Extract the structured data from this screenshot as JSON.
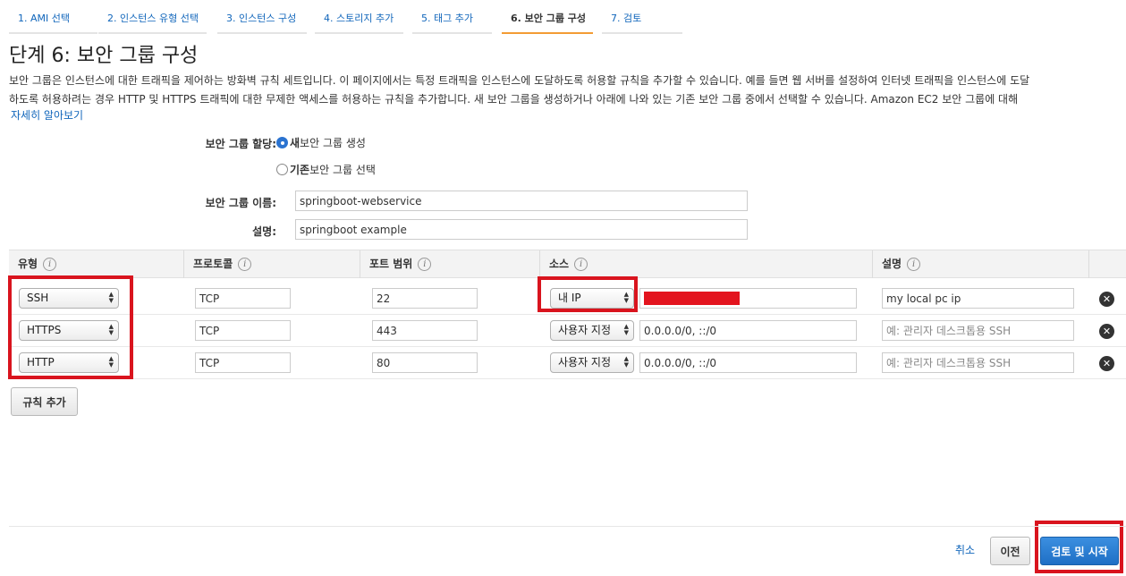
{
  "wizard": {
    "steps": [
      "1. AMI 선택",
      "2. 인스턴스 유형 선택",
      "3. 인스턴스 구성",
      "4. 스토리지 추가",
      "5. 태그 추가",
      "6. 보안 그룹 구성",
      "7. 검토"
    ],
    "active_step": "6. 보안 그룹 구성"
  },
  "header": {
    "title": "단계 6: 보안 그룹 구성",
    "description_line1": "보안 그룹은 인스턴스에 대한 트래픽을 제어하는 방화벽 규칙 세트입니다. 이 페이지에서는 특정 트래픽을 인스턴스에 도달하도록 허용할 규칙을 추가할 수 있습니다. 예를 들면 웹 서버를 설정하여 인터넷 트래픽을 인스턴스에 도달",
    "description_line2": "하도록 허용하려는 경우 HTTP 및 HTTPS 트래픽에 대한 무제한 액세스를 허용하는 규칙을 추가합니다. 새 보안 그룹을 생성하거나 아래에 나와 있는 기존 보안 그룹 중에서 선택할 수 있습니다. Amazon EC2 보안 그룹에 대해",
    "learn_more": "자세히 알아보기"
  },
  "assign": {
    "label": "보안 그룹 할당:",
    "option_new_bold": "새",
    "option_new_rest": " 보안 그룹 생성",
    "option_existing_bold": "기존",
    "option_existing_rest": " 보안 그룹 선택",
    "selected": "new"
  },
  "group_name": {
    "label": "보안 그룹 이름:",
    "value": "springboot-webservice"
  },
  "group_description": {
    "label": "설명:",
    "value": "springboot example"
  },
  "table": {
    "headers": {
      "type": "유형",
      "protocol": "프로토콜",
      "port_range": "포트 범위",
      "source": "소스",
      "description": "설명"
    },
    "info_glyph": "i",
    "rows": [
      {
        "type": "SSH",
        "protocol": "TCP",
        "port": "22",
        "source_select": "내 IP",
        "source_value": "",
        "description": "my local pc ip",
        "description_placeholder": ""
      },
      {
        "type": "HTTPS",
        "protocol": "TCP",
        "port": "443",
        "source_select": "사용자 지정",
        "source_value": "0.0.0.0/0, ::/0",
        "description": "",
        "description_placeholder": "예: 관리자 데스크톱용 SSH"
      },
      {
        "type": "HTTP",
        "protocol": "TCP",
        "port": "80",
        "source_select": "사용자 지정",
        "source_value": "0.0.0.0/0, ::/0",
        "description": "",
        "description_placeholder": "예: 관리자 데스크톱용 SSH"
      }
    ]
  },
  "buttons": {
    "add_rule": "규칙 추가",
    "cancel": "취소",
    "previous": "이전",
    "review_and_launch": "검토 및 시작"
  },
  "icons": {
    "select_arrow_up": "▲",
    "select_arrow_down": "▼",
    "remove": "✕"
  },
  "colors": {
    "link": "#1166bb",
    "active_tab_underline": "#f39c34",
    "primary_button": "#2b7bd4",
    "highlight": "#d9141e",
    "redaction": "#e3141e"
  }
}
